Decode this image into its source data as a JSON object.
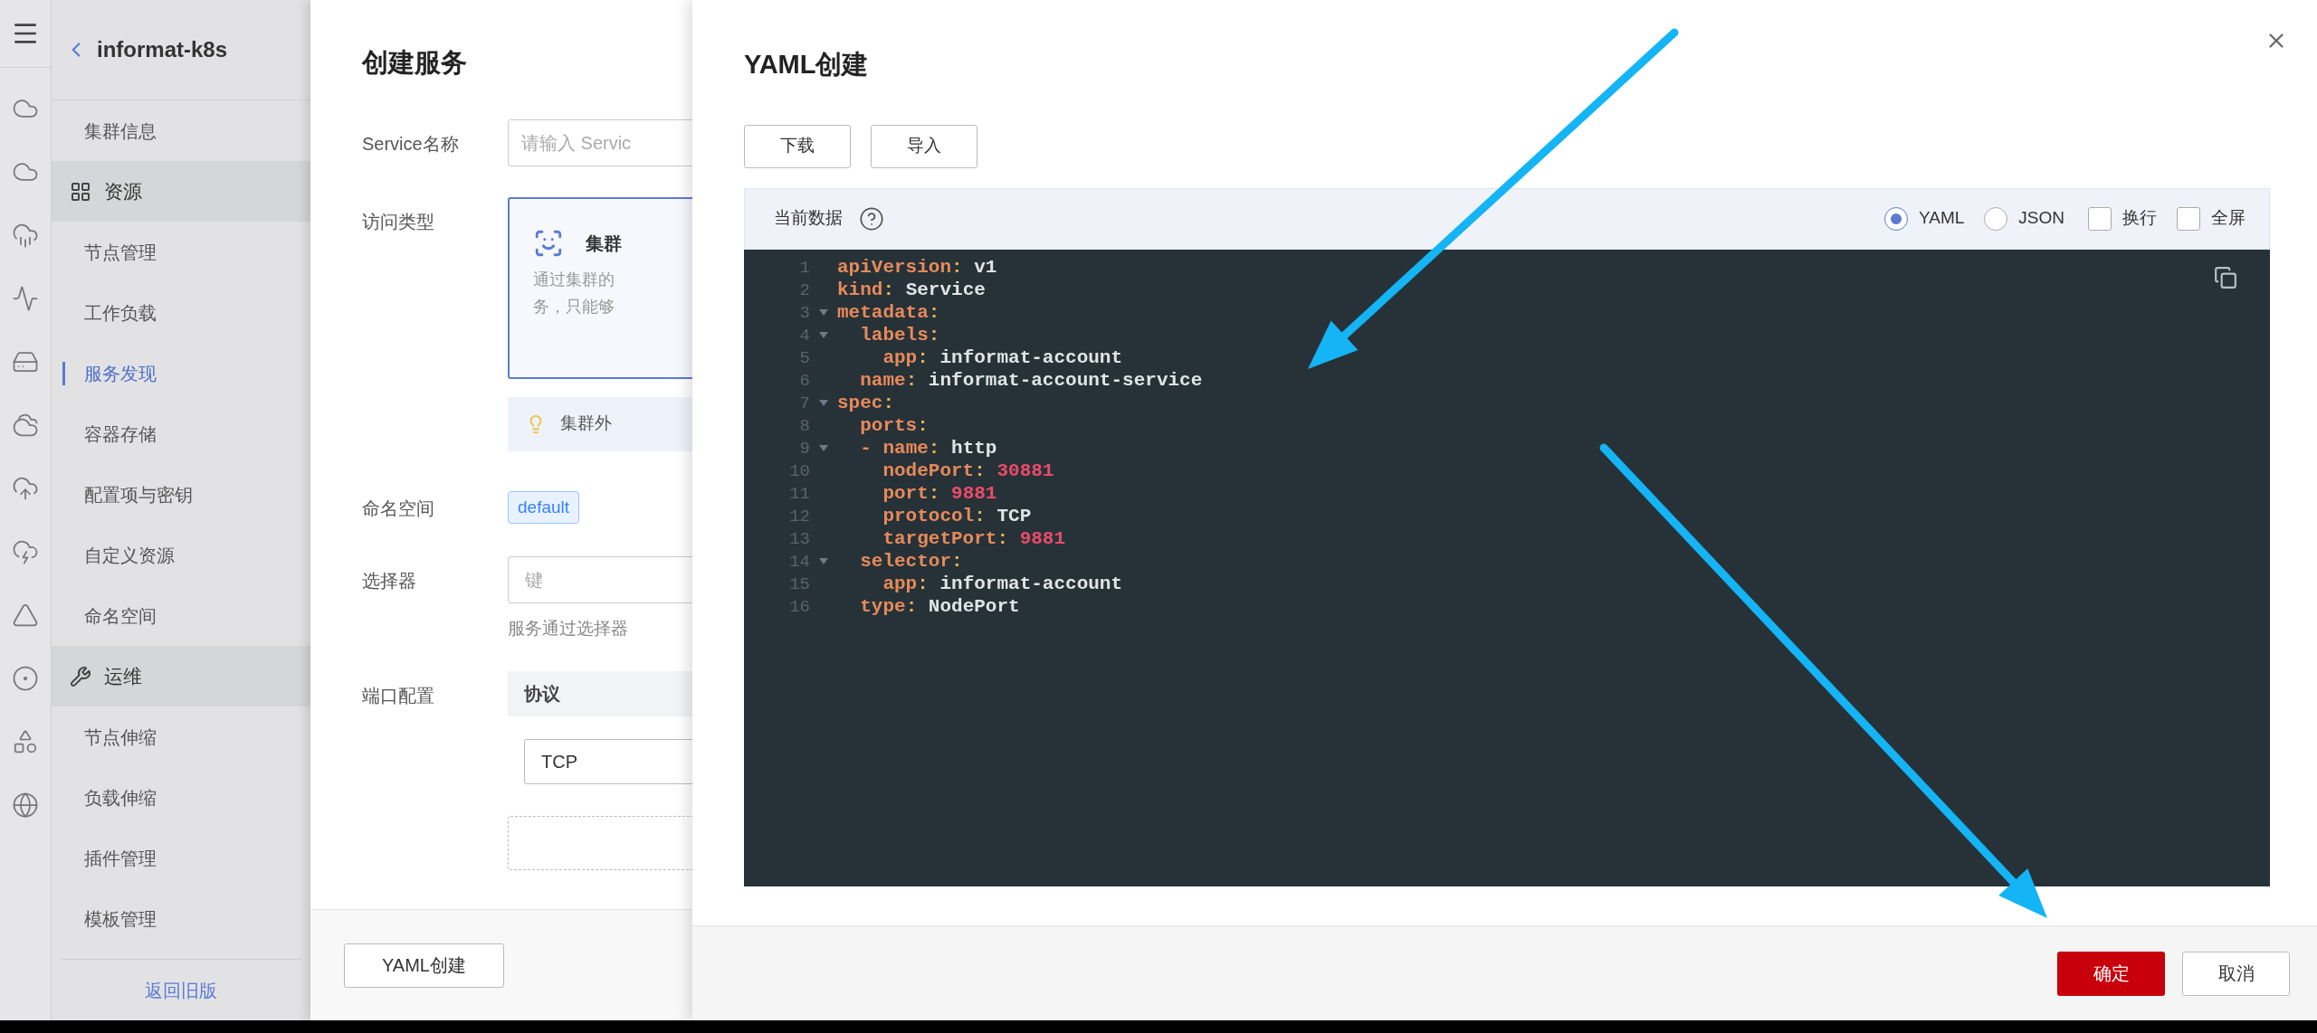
{
  "sidebar": {
    "title": "informat-k8s",
    "items": [
      {
        "kind": "item",
        "label": "集群信息",
        "selected": false
      },
      {
        "kind": "group",
        "label": "资源"
      },
      {
        "kind": "item",
        "label": "节点管理",
        "selected": false
      },
      {
        "kind": "item",
        "label": "工作负载",
        "selected": false
      },
      {
        "kind": "item",
        "label": "服务发现",
        "selected": true
      },
      {
        "kind": "item",
        "label": "容器存储",
        "selected": false
      },
      {
        "kind": "item",
        "label": "配置项与密钥",
        "selected": false
      },
      {
        "kind": "item",
        "label": "自定义资源",
        "selected": false
      },
      {
        "kind": "item",
        "label": "命名空间",
        "selected": false
      },
      {
        "kind": "group",
        "label": "运维"
      },
      {
        "kind": "item",
        "label": "节点伸缩",
        "selected": false
      },
      {
        "kind": "item",
        "label": "负载伸缩",
        "selected": false
      },
      {
        "kind": "item",
        "label": "插件管理",
        "selected": false
      },
      {
        "kind": "item",
        "label": "模板管理",
        "selected": false
      }
    ],
    "footer_link": "返回旧版"
  },
  "form": {
    "title": "创建服务",
    "fields": [
      {
        "kind": "input",
        "label": "Service名称",
        "placeholder": "请输入 Servic"
      },
      {
        "kind": "card",
        "label": "访问类型",
        "card_title": "集群",
        "description": [
          "通过集群的",
          "务，只能够"
        ],
        "selected": true,
        "tip": "集群外"
      },
      {
        "kind": "tag",
        "label": "命名空间",
        "value": "default"
      },
      {
        "kind": "selector",
        "label": "选择器",
        "placeholder": "键",
        "hint": "服务通过选择器"
      },
      {
        "kind": "ports",
        "label": "端口配置",
        "column": "协议",
        "protocol": "TCP"
      }
    ],
    "footer_button": "YAML创建"
  },
  "yaml": {
    "title": "YAML创建",
    "actions": [
      "下载",
      "导入"
    ],
    "editor": {
      "label": "当前数据",
      "formats": [
        {
          "label": "YAML",
          "selected": true
        },
        {
          "label": "JSON",
          "selected": false
        }
      ],
      "options": [
        {
          "label": "换行",
          "checked": false
        },
        {
          "label": "全屏",
          "checked": false
        }
      ],
      "lines": [
        {
          "number": "1",
          "foldable": false,
          "tokens": [
            {
              "kind": "key",
              "text": "apiVersion"
            },
            {
              "kind": "punct",
              "text": ": "
            },
            {
              "kind": "string",
              "text": "v1"
            }
          ]
        },
        {
          "number": "2",
          "foldable": false,
          "tokens": [
            {
              "kind": "key",
              "text": "kind"
            },
            {
              "kind": "punct",
              "text": ": "
            },
            {
              "kind": "string",
              "text": "Service"
            }
          ]
        },
        {
          "number": "3",
          "foldable": true,
          "tokens": [
            {
              "kind": "key",
              "text": "metadata"
            },
            {
              "kind": "punct",
              "text": ":"
            }
          ]
        },
        {
          "number": "4",
          "foldable": true,
          "tokens": [
            {
              "kind": "key",
              "text": "  labels"
            },
            {
              "kind": "punct",
              "text": ":"
            }
          ]
        },
        {
          "number": "5",
          "foldable": false,
          "tokens": [
            {
              "kind": "key",
              "text": "    app"
            },
            {
              "kind": "punct",
              "text": ": "
            },
            {
              "kind": "string",
              "text": "informat-account"
            }
          ]
        },
        {
          "number": "6",
          "foldable": false,
          "tokens": [
            {
              "kind": "key",
              "text": "  name"
            },
            {
              "kind": "punct",
              "text": ": "
            },
            {
              "kind": "string",
              "text": "informat-account-service"
            }
          ]
        },
        {
          "number": "7",
          "foldable": true,
          "tokens": [
            {
              "kind": "key",
              "text": "spec"
            },
            {
              "kind": "punct",
              "text": ":"
            }
          ]
        },
        {
          "number": "8",
          "foldable": false,
          "tokens": [
            {
              "kind": "key",
              "text": "  ports"
            },
            {
              "kind": "punct",
              "text": ":"
            }
          ]
        },
        {
          "number": "9",
          "foldable": true,
          "tokens": [
            {
              "kind": "dash",
              "text": "  - "
            },
            {
              "kind": "key",
              "text": "name"
            },
            {
              "kind": "punct",
              "text": ": "
            },
            {
              "kind": "string",
              "text": "http"
            }
          ]
        },
        {
          "number": "10",
          "foldable": false,
          "tokens": [
            {
              "kind": "key",
              "text": "    nodePort"
            },
            {
              "kind": "punct",
              "text": ": "
            },
            {
              "kind": "number",
              "text": "30881"
            }
          ]
        },
        {
          "number": "11",
          "foldable": false,
          "tokens": [
            {
              "kind": "key",
              "text": "    port"
            },
            {
              "kind": "punct",
              "text": ": "
            },
            {
              "kind": "number",
              "text": "9881"
            }
          ]
        },
        {
          "number": "12",
          "foldable": false,
          "tokens": [
            {
              "kind": "key",
              "text": "    protocol"
            },
            {
              "kind": "punct",
              "text": ": "
            },
            {
              "kind": "string",
              "text": "TCP"
            }
          ]
        },
        {
          "number": "13",
          "foldable": false,
          "tokens": [
            {
              "kind": "key",
              "text": "    targetPort"
            },
            {
              "kind": "punct",
              "text": ": "
            },
            {
              "kind": "number",
              "text": "9881"
            }
          ]
        },
        {
          "number": "14",
          "foldable": true,
          "tokens": [
            {
              "kind": "key",
              "text": "  selector"
            },
            {
              "kind": "punct",
              "text": ":"
            }
          ]
        },
        {
          "number": "15",
          "foldable": false,
          "tokens": [
            {
              "kind": "key",
              "text": "    app"
            },
            {
              "kind": "punct",
              "text": ": "
            },
            {
              "kind": "string",
              "text": "informat-account"
            }
          ]
        },
        {
          "number": "16",
          "foldable": false,
          "tokens": [
            {
              "kind": "key",
              "text": "  type"
            },
            {
              "kind": "punct",
              "text": ": "
            },
            {
              "kind": "string",
              "text": "NodePort"
            }
          ]
        }
      ]
    },
    "buttons": [
      {
        "kind": "primary",
        "label": "确定"
      },
      {
        "kind": "default",
        "label": "取消"
      }
    ]
  }
}
